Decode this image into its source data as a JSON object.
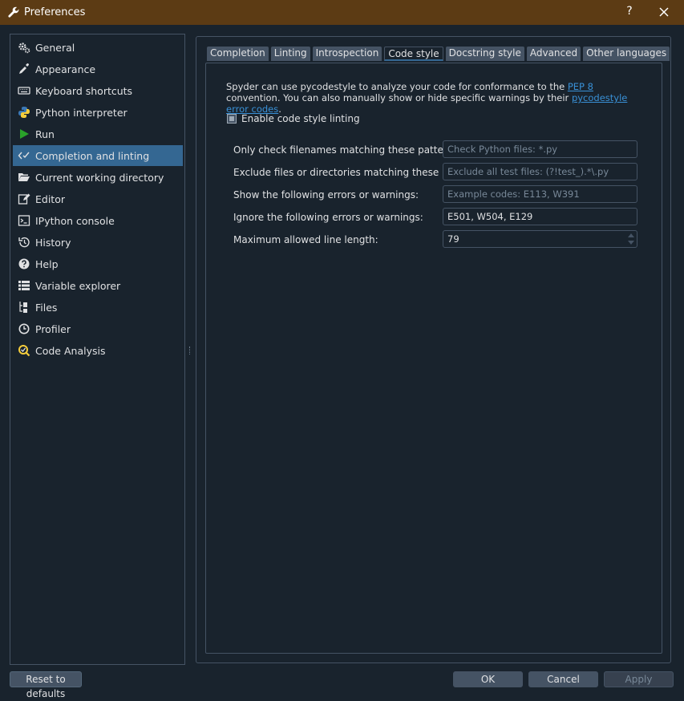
{
  "window": {
    "title": "Preferences",
    "help_label": "?"
  },
  "sidebar": {
    "items": [
      {
        "label": "General",
        "icon": "gears-icon"
      },
      {
        "label": "Appearance",
        "icon": "eyedropper-icon"
      },
      {
        "label": "Keyboard shortcuts",
        "icon": "keyboard-icon"
      },
      {
        "label": "Python interpreter",
        "icon": "python-icon"
      },
      {
        "label": "Run",
        "icon": "play-icon"
      },
      {
        "label": "Completion and linting",
        "icon": "code-check-icon",
        "active": true
      },
      {
        "label": "Current working directory",
        "icon": "folder-open-icon"
      },
      {
        "label": "Editor",
        "icon": "edit-icon"
      },
      {
        "label": "IPython console",
        "icon": "terminal-icon"
      },
      {
        "label": "History",
        "icon": "history-icon"
      },
      {
        "label": "Help",
        "icon": "question-icon"
      },
      {
        "label": "Variable explorer",
        "icon": "table-icon"
      },
      {
        "label": "Files",
        "icon": "files-tree-icon"
      },
      {
        "label": "Profiler",
        "icon": "clock-icon"
      },
      {
        "label": "Code Analysis",
        "icon": "code-analysis-icon"
      }
    ]
  },
  "tabs": [
    {
      "label": "Completion"
    },
    {
      "label": "Linting"
    },
    {
      "label": "Introspection"
    },
    {
      "label": "Code style",
      "active": true
    },
    {
      "label": "Docstring style"
    },
    {
      "label": "Advanced"
    },
    {
      "label": "Other languages"
    }
  ],
  "codestyle": {
    "desc_part1": "Spyder can use pycodestyle to analyze your code for conformance to the ",
    "pep8_link": "PEP 8",
    "desc_part2": " convention. You can also manually show or hide specific warnings by their ",
    "error_codes_link": "pycodestyle error codes",
    "desc_part3": ".",
    "enable_label": "Enable code style linting",
    "enable_checked": "partial",
    "fields": {
      "filename_patterns": {
        "label": "Only check filenames matching these patterns:",
        "value": "",
        "placeholder": "Check Python files: *.py"
      },
      "exclude": {
        "label": "Exclude files or directories matching these patterns:",
        "value": "",
        "placeholder": "Exclude all test files: (?!test_).*\\.py"
      },
      "select": {
        "label": "Show the following errors or warnings:",
        "value": "",
        "placeholder": "Example codes: E113, W391"
      },
      "ignore": {
        "label": "Ignore the following errors or warnings:",
        "value": "E501, W504, E129",
        "placeholder": ""
      },
      "max_line_length": {
        "label": "Maximum allowed line length:",
        "value": "79"
      }
    }
  },
  "buttons": {
    "reset": "Reset to defaults",
    "ok": "OK",
    "cancel": "Cancel",
    "apply": "Apply"
  },
  "colors": {
    "titlebar": "#5c3b14",
    "background": "#19232d",
    "selection": "#346792",
    "border": "#455364",
    "link": "#3990d6",
    "run_green": "#2aa22a"
  }
}
